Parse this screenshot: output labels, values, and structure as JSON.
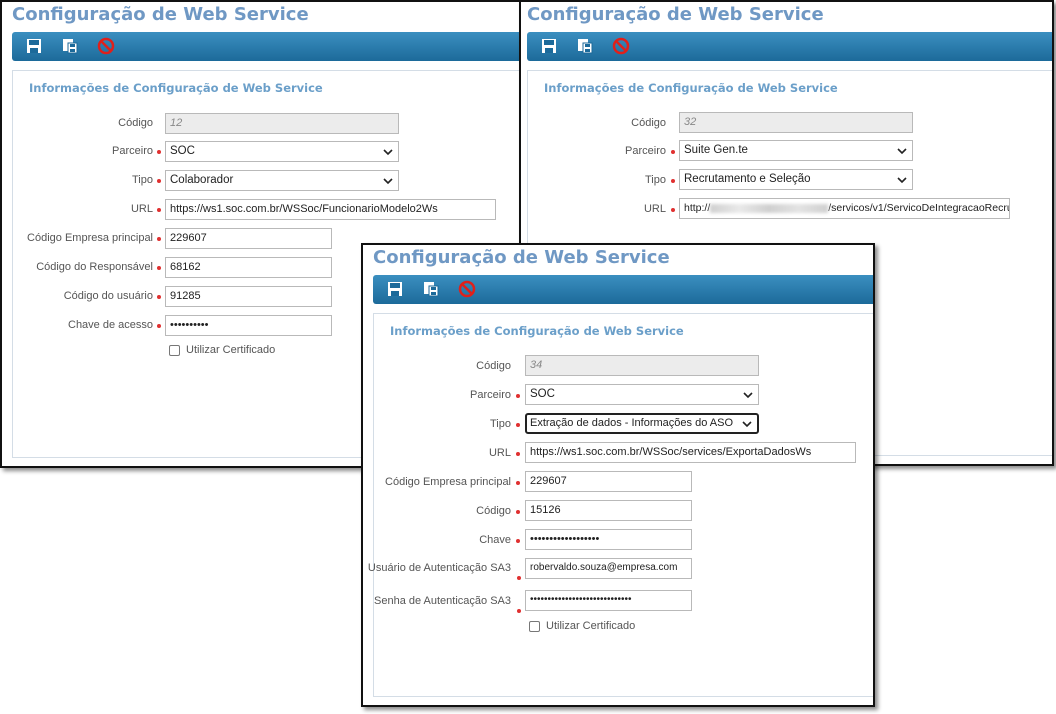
{
  "window_title": "Configuração de Web Service",
  "panel_title": "Informações de Configuração de Web Service",
  "win1": {
    "codigo_label": "Código",
    "codigo_value": "12",
    "parceiro_label": "Parceiro",
    "parceiro_value": "SOC",
    "tipo_label": "Tipo",
    "tipo_value": "Colaborador",
    "url_label": "URL",
    "url_value": "https://ws1.soc.com.br/WSSoc/FuncionarioModelo2Ws",
    "empresa_label": "Código Empresa principal",
    "empresa_value": "229607",
    "responsavel_label": "Código do Responsável",
    "responsavel_value": "68162",
    "usuario_label": "Código do usuário",
    "usuario_value": "91285",
    "chave_label": "Chave de acesso",
    "chave_value": "••••••••••",
    "certificado_label": "Utilizar Certificado"
  },
  "win2": {
    "codigo_label": "Código",
    "codigo_value": "32",
    "parceiro_label": "Parceiro",
    "parceiro_value": "Suite Gen.te",
    "tipo_label": "Tipo",
    "tipo_value": "Recrutamento e Seleção",
    "url_label": "URL",
    "url_prefix": "http://",
    "url_suffix": "/servicos/v1/ServicoDeIntegracaoRecru"
  },
  "win3": {
    "codigo_label": "Código",
    "codigo_value": "34",
    "parceiro_label": "Parceiro",
    "parceiro_value": "SOC",
    "tipo_label": "Tipo",
    "tipo_value": "Extração de dados - Informações do ASO",
    "url_label": "URL",
    "url_value": "https://ws1.soc.com.br/WSSoc/services/ExportaDadosWs",
    "empresa_label": "Código Empresa principal",
    "empresa_value": "229607",
    "codigo2_label": "Código",
    "codigo2_value": "15126",
    "chave_label": "Chave",
    "chave_value": "••••••••••••••••••",
    "usuario_sa3_label": "Usuário de Autenticação SA3",
    "usuario_sa3_value": "robervaldo.souza@empresa.com",
    "senha_sa3_label": "Senha de Autenticação SA3",
    "senha_sa3_value": "•••••••••••••••••••••••••••••",
    "certificado_label": "Utilizar Certificado"
  },
  "colors": {
    "title": "#6f98c4",
    "toolbar": "#1c6a9a",
    "required": "#e03030"
  },
  "icons": [
    "save-icon",
    "save-as-icon",
    "cancel-icon"
  ]
}
